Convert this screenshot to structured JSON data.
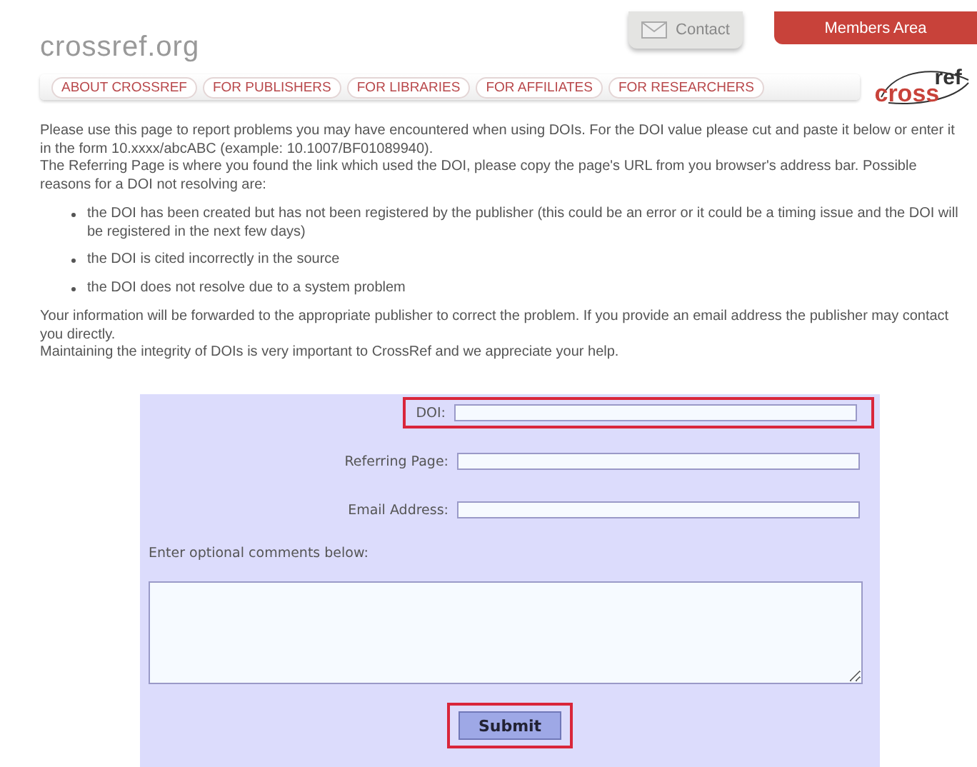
{
  "header": {
    "site_logo": "crossref.org",
    "contact": "Contact",
    "members_area": "Members Area",
    "brand_logo": {
      "part_1": "cross",
      "part_2": "ref"
    }
  },
  "nav": [
    {
      "label": "ABOUT CROSSREF"
    },
    {
      "label": "FOR PUBLISHERS"
    },
    {
      "label": "FOR LIBRARIES"
    },
    {
      "label": "FOR AFFILIATES"
    },
    {
      "label": "FOR RESEARCHERS"
    }
  ],
  "intro": [
    "Please use this page to report problems you may have encountered when using DOIs. For the DOI value please cut and paste it below or enter it in the form 10.xxxx/abcABC (example: 10.1007/BF01089940).",
    "The Referring Page is where you found the link which used the DOI, please copy the page's URL from you browser's address bar. Possible reasons for a DOI not resolving are:"
  ],
  "reasons": [
    "the DOI has been created but has not been registered by the publisher (this could be an error or it could be a timing issue and the DOI will be registered in the next few days)",
    "the DOI is cited incorrectly in the source",
    "the DOI does not resolve due to a system problem"
  ],
  "outro": [
    "Your information will be forwarded to the appropriate publisher to correct the problem. If you provide an email address the publisher may contact you directly.",
    "Maintaining the integrity of DOIs is very important to CrossRef and we appreciate your help."
  ],
  "form": {
    "fields": [
      {
        "label": "DOI:",
        "highlighted": true
      },
      {
        "label": "Referring Page:",
        "highlighted": false
      },
      {
        "label": "Email Address:",
        "highlighted": false
      }
    ],
    "comments_label": "Enter optional comments below:",
    "submit": {
      "label": "Submit",
      "highlighted": true
    }
  }
}
